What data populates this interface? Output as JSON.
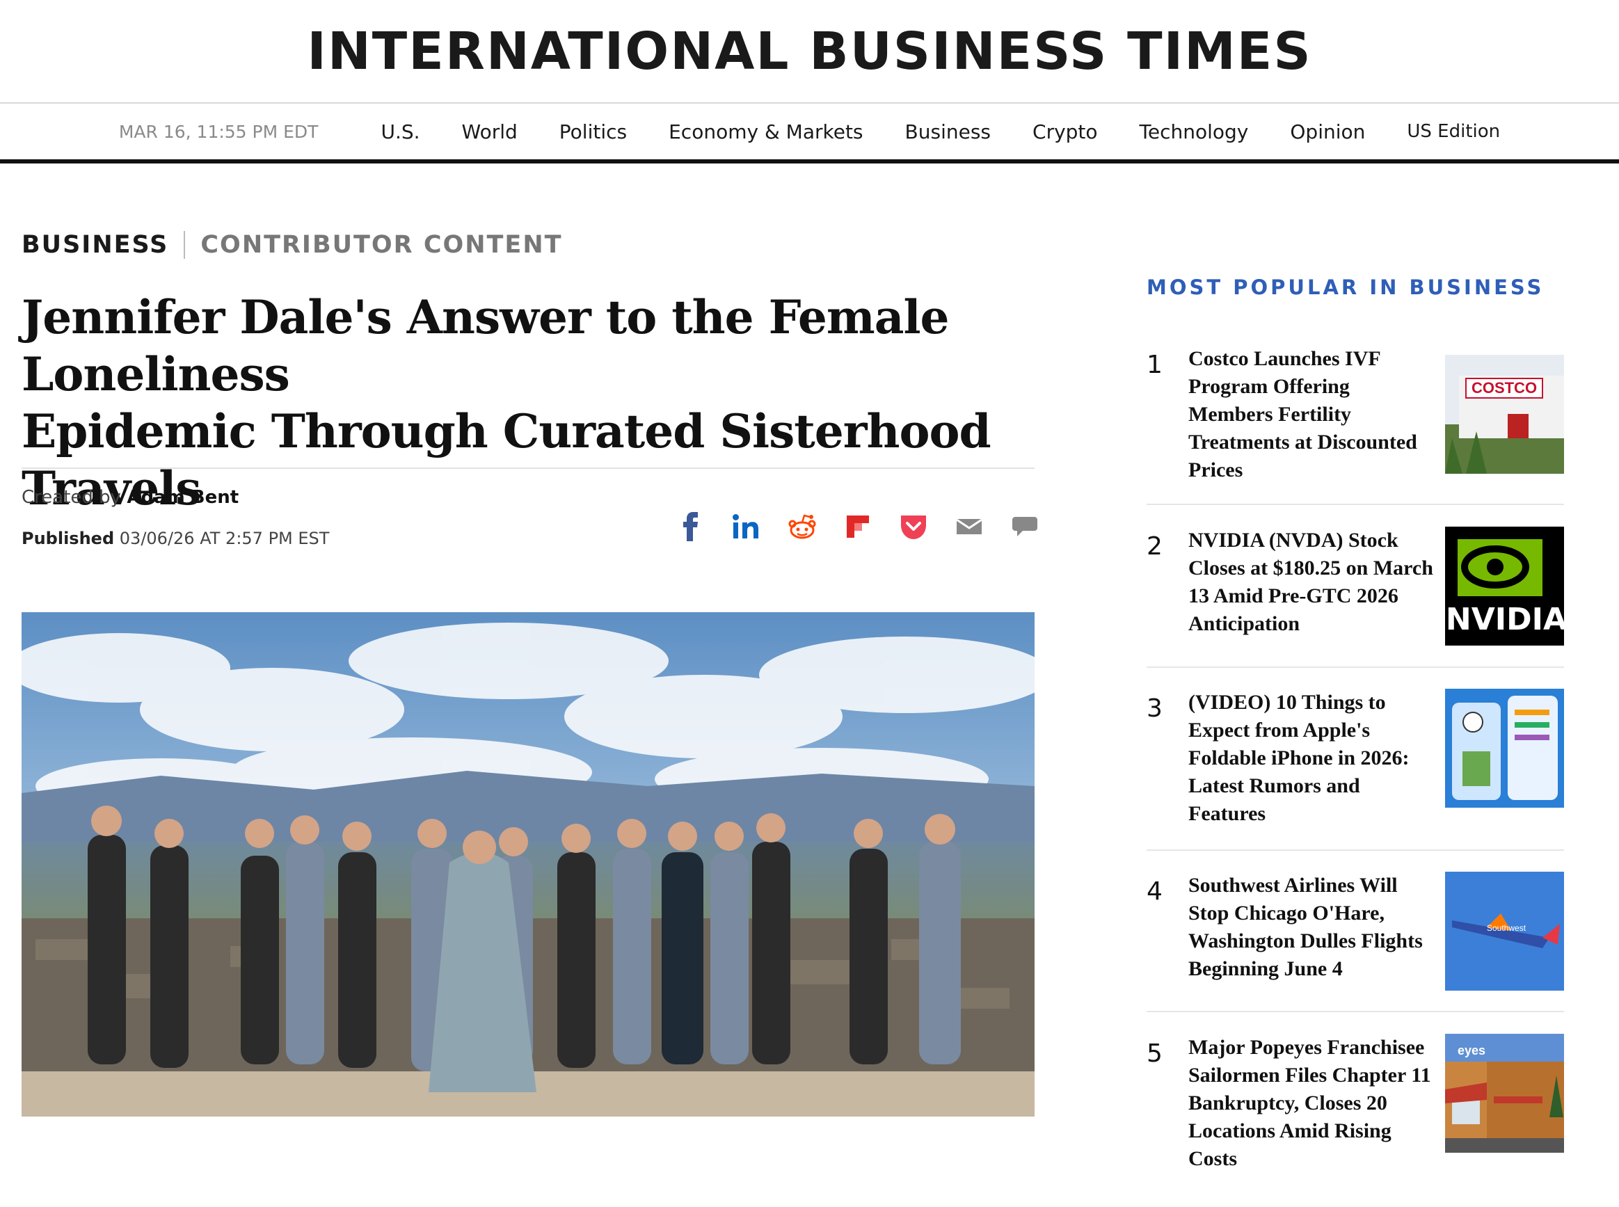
{
  "masthead": {
    "brand": "INTERNATIONAL BUSINESS TIMES"
  },
  "nav": {
    "date": "MAR 16, 11:55 PM EDT",
    "items": [
      "U.S.",
      "World",
      "Politics",
      "Economy & Markets",
      "Business",
      "Crypto",
      "Technology",
      "Opinion"
    ],
    "edition": "US Edition"
  },
  "article": {
    "category": "BUSINESS",
    "subcategory": "CONTRIBUTOR CONTENT",
    "headline_line1": "Jennifer Dale's Answer to the Female Loneliness",
    "headline_line2": "Epidemic Through Curated Sisterhood Travels",
    "created_by_label": "Created by",
    "author": "Adam Bent",
    "published_label": "Published",
    "published_value": "03/06/26 AT 2:57 PM EST"
  },
  "share_icons": [
    "facebook-icon",
    "linkedin-icon",
    "reddit-icon",
    "flipboard-icon",
    "pocket-icon",
    "email-icon",
    "comment-icon"
  ],
  "colors": {
    "accent_blue": "#2f5eb8",
    "facebook": "#3b5998",
    "linkedin": "#0a66c2",
    "reddit": "#ff4500",
    "flipboard": "#e12828",
    "pocket": "#ef4056",
    "gray_icon": "#888888"
  },
  "sidebar": {
    "title": "MOST POPULAR IN BUSINESS",
    "items": [
      {
        "rank": "1",
        "title": "Costco Launches IVF Program Offering Members Fertility Treatments at Discounted Prices",
        "thumb_text": "COSTCO"
      },
      {
        "rank": "2",
        "title": "NVIDIA (NVDA) Stock Closes at $180.25 on March 13 Amid Pre-GTC 2026 Anticipation",
        "thumb_text": "NVIDIA"
      },
      {
        "rank": "3",
        "title": "(VIDEO) 10 Things to Expect from Apple's Foldable iPhone in 2026: Latest Rumors and Features",
        "thumb_text": ""
      },
      {
        "rank": "4",
        "title": "Southwest Airlines Will Stop Chicago O'Hare, Washington Dulles Flights Beginning June 4",
        "thumb_text": "Southwest"
      },
      {
        "rank": "5",
        "title": "Major Popeyes Franchisee Sailormen Files Chapter 11 Bankruptcy, Closes 20 Locations Amid Rising Costs",
        "thumb_text": "eyes"
      }
    ]
  }
}
